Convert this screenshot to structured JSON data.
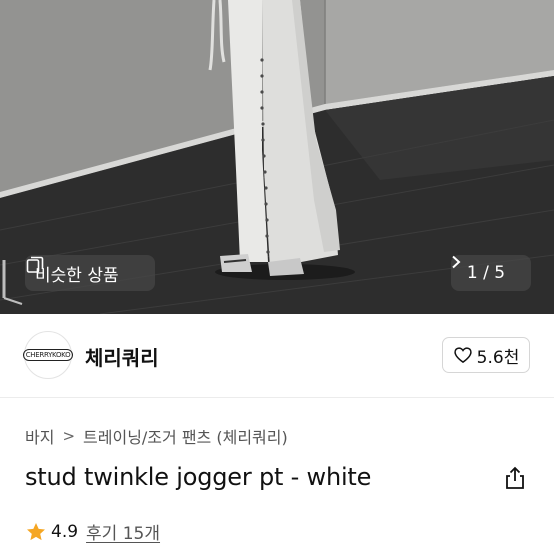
{
  "hero": {
    "similar_label": "비슷한 상품",
    "counter": "1 / 5",
    "icons": {
      "similar": "stack-icon",
      "next": "chevron-right-icon"
    }
  },
  "brand": {
    "logo_text": "CHERRYKOKO",
    "name": "체리쿼리",
    "likes": "5.6천",
    "like_icon": "heart-outline-icon"
  },
  "breadcrumb": {
    "items": [
      "바지",
      "트레이닝/조거 팬츠 (체리쿼리)"
    ]
  },
  "product": {
    "title": "stud twinkle jogger pt - white",
    "share_icon": "share-icon"
  },
  "rating": {
    "score": "4.9",
    "reviews": "후기 15개",
    "star_color": "#f5a623"
  }
}
